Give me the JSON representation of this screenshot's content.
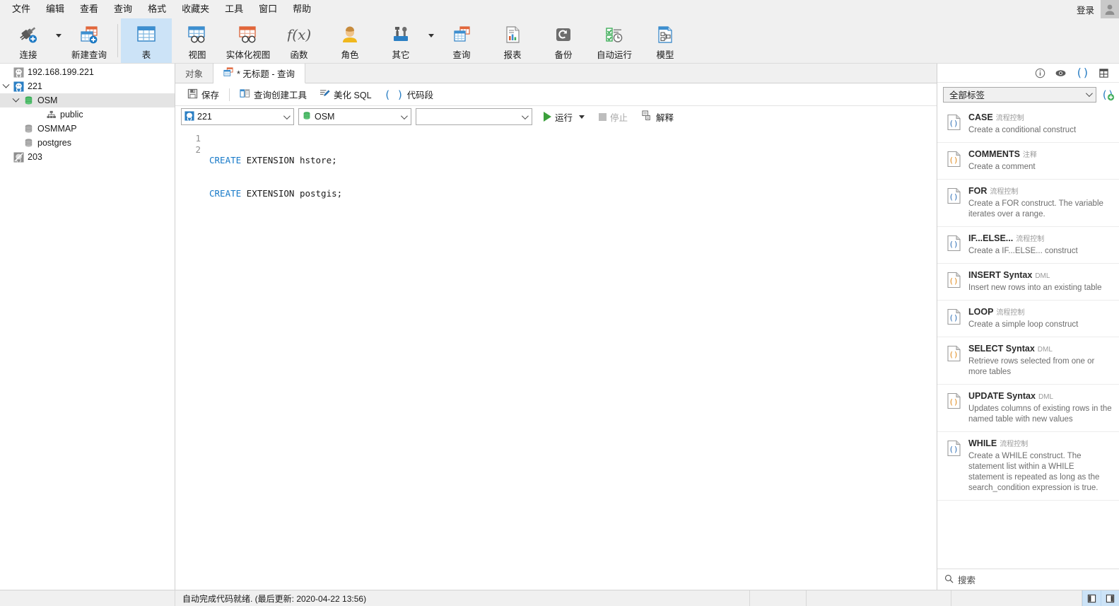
{
  "menubar": {
    "items": [
      "文件",
      "编辑",
      "查看",
      "查询",
      "格式",
      "收藏夹",
      "工具",
      "窗口",
      "帮助"
    ],
    "login_label": "登录"
  },
  "toolbar": {
    "buttons": [
      {
        "label": "连接",
        "icon": "connection-icon",
        "has_caret": true,
        "active": false
      },
      {
        "label": "新建查询",
        "icon": "new-query-icon",
        "has_caret": false,
        "active": false
      },
      {
        "label": "表",
        "icon": "table-icon",
        "has_caret": false,
        "active": true
      },
      {
        "label": "视图",
        "icon": "view-icon",
        "has_caret": false,
        "active": false
      },
      {
        "label": "实体化视图",
        "icon": "materialized-view-icon",
        "has_caret": false,
        "active": false
      },
      {
        "label": "函数",
        "icon": "function-icon",
        "has_caret": false,
        "active": false
      },
      {
        "label": "角色",
        "icon": "role-icon",
        "has_caret": false,
        "active": false
      },
      {
        "label": "其它",
        "icon": "others-icon",
        "has_caret": true,
        "active": false
      },
      {
        "label": "查询",
        "icon": "query-icon",
        "has_caret": false,
        "active": false
      },
      {
        "label": "报表",
        "icon": "report-icon",
        "has_caret": false,
        "active": false
      },
      {
        "label": "备份",
        "icon": "backup-icon",
        "has_caret": false,
        "active": false
      },
      {
        "label": "自动运行",
        "icon": "automation-icon",
        "has_caret": false,
        "active": false
      },
      {
        "label": "模型",
        "icon": "model-icon",
        "has_caret": false,
        "active": false
      }
    ]
  },
  "sidebar": {
    "nodes": [
      {
        "label": "192.168.199.221",
        "icon": "postgres-server-icon",
        "indent": 0,
        "twisty": "none",
        "selected": false
      },
      {
        "label": "221",
        "icon": "postgres-server-icon-active",
        "indent": 0,
        "twisty": "expanded",
        "selected": false
      },
      {
        "label": "OSM",
        "icon": "database-icon-active",
        "indent": 1,
        "twisty": "expanded",
        "selected": true
      },
      {
        "label": "public",
        "icon": "schema-icon",
        "indent": 2,
        "twisty": "none",
        "selected": false
      },
      {
        "label": "OSMMAP",
        "icon": "database-icon",
        "indent": 1,
        "twisty": "none",
        "selected": false
      },
      {
        "label": "postgres",
        "icon": "database-icon",
        "indent": 1,
        "twisty": "none",
        "selected": false
      },
      {
        "label": "203",
        "icon": "server-offline-icon",
        "indent": 0,
        "twisty": "none",
        "selected": false
      }
    ]
  },
  "tabs": [
    {
      "label": "对象",
      "icon": "none",
      "active": false
    },
    {
      "label": "* 无标题 - 查询",
      "icon": "query-tab-icon",
      "active": true
    }
  ],
  "query_toolbar": {
    "save_label": "保存",
    "query_builder_label": "查询创建工具",
    "beautify_label": "美化 SQL",
    "snippet_label": "代码段"
  },
  "selectbar": {
    "connection": {
      "value": "221",
      "icon": "postgres-server-icon"
    },
    "database": {
      "value": "OSM",
      "icon": "database-icon-active"
    },
    "schema": {
      "value": "",
      "icon": "none"
    },
    "run_label": "运行",
    "stop_label": "停止",
    "explain_label": "解释",
    "stop_disabled": true
  },
  "editor": {
    "line_numbers": [
      "1",
      "2"
    ],
    "lines": [
      {
        "keyword": "CREATE",
        "rest": " EXTENSION hstore;"
      },
      {
        "keyword": "CREATE",
        "rest": " EXTENSION postgis;"
      }
    ]
  },
  "right_panel": {
    "header_icons": [
      "info-icon",
      "preview-eye-icon",
      "code-snippet-icon",
      "structure-grid-icon"
    ],
    "filter": {
      "value": "全部标签"
    },
    "add_snippet_icon": "add-snippet-icon",
    "snippets": [
      {
        "title": "CASE",
        "tag": "流程控制",
        "desc": "Create a conditional construct",
        "color": "#2f6fb5"
      },
      {
        "title": "COMMENTS",
        "tag": "注释",
        "desc": "Create a comment",
        "color": "#e08a1e"
      },
      {
        "title": "FOR",
        "tag": "流程控制",
        "desc": "Create a FOR construct. The variable iterates over a range.",
        "color": "#2f6fb5"
      },
      {
        "title": "IF...ELSE...",
        "tag": "流程控制",
        "desc": "Create a IF...ELSE... construct",
        "color": "#2f6fb5"
      },
      {
        "title": "INSERT Syntax",
        "tag": "DML",
        "desc": "Insert new rows into an existing table",
        "color": "#e08a1e"
      },
      {
        "title": "LOOP",
        "tag": "流程控制",
        "desc": "Create a simple loop construct",
        "color": "#2f6fb5"
      },
      {
        "title": "SELECT Syntax",
        "tag": "DML",
        "desc": "Retrieve rows selected from one or more tables",
        "color": "#e08a1e"
      },
      {
        "title": "UPDATE Syntax",
        "tag": "DML",
        "desc": "Updates columns of existing rows in the named table with new values",
        "color": "#e08a1e"
      },
      {
        "title": "WHILE",
        "tag": "流程控制",
        "desc": "Create a WHILE construct. The statement list within a WHILE statement is repeated as long as the search_condition expression is true.",
        "color": "#2f6fb5"
      }
    ],
    "search_placeholder": "搜索"
  },
  "statusbar": {
    "message": "自动完成代码就绪. (最后更新: 2020-04-22 13:56)",
    "toggles": [
      "left-panel-toggle",
      "right-panel-toggle"
    ]
  },
  "colors": {
    "accent": "#cce3f7",
    "keyword": "#1679c8",
    "db_green": "#2fa84f",
    "run_green": "#3ba03b"
  }
}
